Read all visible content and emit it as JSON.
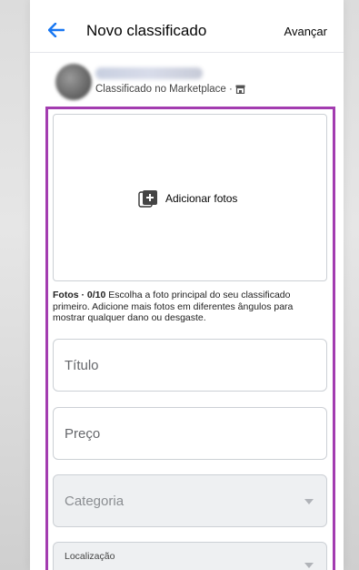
{
  "header": {
    "back_icon": "arrow-left-icon",
    "title": "Novo classificado",
    "next_label": "Avançar",
    "accent": "#1877f2"
  },
  "profile": {
    "subtitle": "Classificado no Marketplace ·",
    "shop_icon": "shop-icon"
  },
  "photos": {
    "add_label": "Adicionar fotos",
    "help_bold": "Fotos · 0/10",
    "help_text": " Escolha a foto principal do seu classificado primeiro. Adicione mais fotos em diferentes ângulos para mostrar qualquer dano ou desgaste."
  },
  "form": {
    "title_placeholder": "Título",
    "price_placeholder": "Preço",
    "category_placeholder": "Categoria",
    "location_label": "Localização"
  },
  "highlight_color": "#a33cb0"
}
